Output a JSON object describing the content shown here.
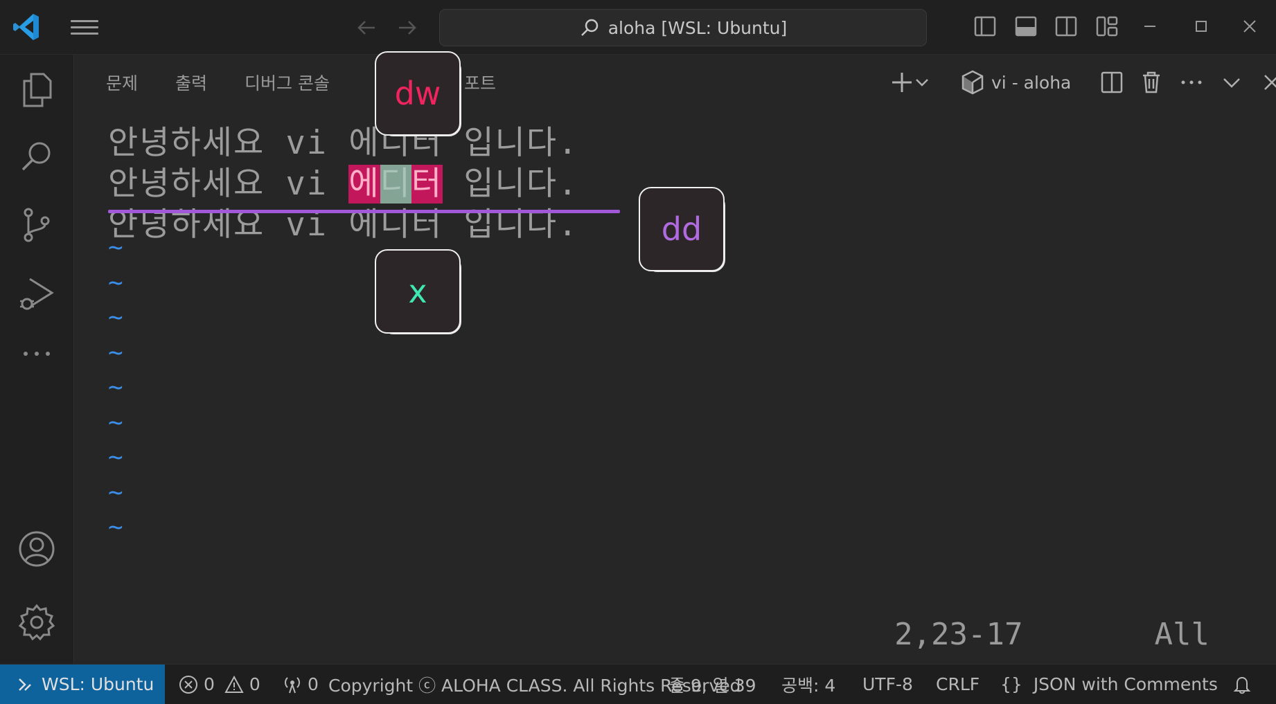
{
  "titlebar": {
    "search_text": "aloha [WSL: Ubuntu]",
    "icons": [
      "vscode-logo-icon",
      "menu-icon",
      "back-arrow-icon",
      "forward-arrow-icon",
      "search-icon",
      "toggle-primary-sidebar-icon",
      "toggle-panel-icon",
      "toggle-secondary-sidebar-icon",
      "customize-layout-icon",
      "minimize-icon",
      "maximize-icon",
      "close-icon"
    ]
  },
  "activity_bar": {
    "items": [
      "explorer-icon",
      "search-icon",
      "source-control-icon",
      "run-debug-icon",
      "more-icon",
      "accounts-icon",
      "settings-gear-icon"
    ]
  },
  "panel": {
    "tabs": [
      "문제",
      "출력",
      "디버그 콘솔"
    ],
    "tab_ports_partial": "포트",
    "terminal_name": "vi - aloha"
  },
  "terminal": {
    "lines": [
      {
        "pre": "안녕하세요 vi ",
        "mid": "에디터",
        "post": " 입니다."
      },
      {
        "pre": "안녕하세요 vi ",
        "hl1": "에",
        "hl2": "디",
        "hl3": "터",
        "post": " 입니다."
      },
      {
        "pre": "안녕하세요 vi ",
        "mid": "에디터",
        "post": " 입니다."
      }
    ],
    "tilde": "~",
    "tilde_count": 9,
    "cursor_pos": "2,23-17",
    "scroll_pos": "All"
  },
  "callouts": {
    "dw": {
      "label": "dw",
      "color": "#f0245f"
    },
    "dd": {
      "label": "dd",
      "color": "#b06be0"
    },
    "x": {
      "label": "x",
      "color": "#3ee8b0"
    }
  },
  "statusbar": {
    "remote": "WSL: Ubuntu",
    "errors": "0",
    "warnings": "0",
    "ports": "0",
    "copyright": "Copyright ⓒ ALOHA CLASS. All Rights Reserved",
    "position": "줄 9, 열 39",
    "indent": "공백: 4",
    "encoding": "UTF-8",
    "eol": "CRLF",
    "language_braces": "{}",
    "language": "JSON with Comments"
  },
  "colors": {
    "accent_remote": "#0e639c",
    "strike": "#a259d9",
    "highlight_red": "#c2185b",
    "tilde": "#3b8eea"
  }
}
